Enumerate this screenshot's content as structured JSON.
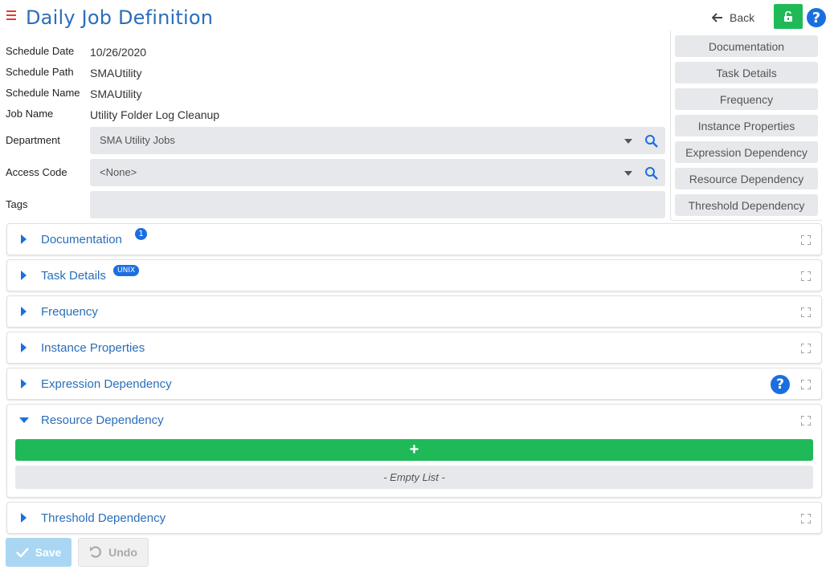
{
  "header": {
    "title": "Daily Job Definition",
    "back_label": "Back"
  },
  "fields": {
    "schedule_date": {
      "label": "Schedule Date",
      "value": "10/26/2020"
    },
    "schedule_path": {
      "label": "Schedule Path",
      "value": "SMAUtility"
    },
    "schedule_name": {
      "label": "Schedule Name",
      "value": "SMAUtility"
    },
    "job_name": {
      "label": "Job Name",
      "value": "Utility Folder Log Cleanup"
    },
    "department": {
      "label": "Department",
      "value": "SMA Utility Jobs"
    },
    "access_code": {
      "label": "Access Code",
      "value": "<None>"
    },
    "tags": {
      "label": "Tags",
      "value": ""
    }
  },
  "side_nav": [
    "Documentation",
    "Task Details",
    "Frequency",
    "Instance Properties",
    "Expression Dependency",
    "Resource Dependency",
    "Threshold Dependency"
  ],
  "panels": {
    "documentation": {
      "title": "Documentation",
      "badge": "1"
    },
    "task_details": {
      "title": "Task Details",
      "badge": "UNIX"
    },
    "frequency": {
      "title": "Frequency"
    },
    "instance_properties": {
      "title": "Instance Properties"
    },
    "expression_dependency": {
      "title": "Expression Dependency"
    },
    "resource_dependency": {
      "title": "Resource Dependency",
      "add_label": "+",
      "empty_label": "- Empty List -"
    },
    "threshold_dependency": {
      "title": "Threshold Dependency"
    }
  },
  "footer": {
    "save_label": "Save",
    "undo_label": "Undo"
  },
  "colors": {
    "accent_blue": "#2a6ebb",
    "icon_blue": "#1a6fe0",
    "green": "#1fba57",
    "menu_red": "#e53935"
  }
}
